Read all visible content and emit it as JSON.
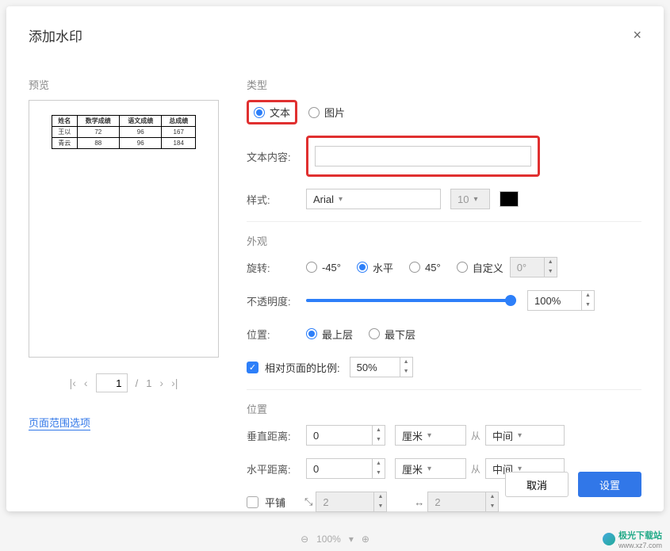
{
  "dialog": {
    "title": "添加水印",
    "close": "×"
  },
  "preview": {
    "title": "预览",
    "table": {
      "headers": [
        "姓名",
        "数学成绩",
        "语文成绩",
        "总成绩"
      ],
      "rows": [
        [
          "王以",
          "72",
          "96",
          "167"
        ],
        [
          "青云",
          "88",
          "96",
          "184"
        ]
      ]
    }
  },
  "pager": {
    "first": "|‹",
    "prev": "‹",
    "current": "1",
    "sep": "/",
    "total": "1",
    "next": "›",
    "last": "›|"
  },
  "page_range_link": "页面范围选项",
  "type_section": {
    "title": "类型",
    "text_radio": "文本",
    "image_radio": "图片",
    "content_label": "文本内容:",
    "content_value": "",
    "style_label": "样式:",
    "font": "Arial",
    "size": "10"
  },
  "appearance": {
    "title": "外观",
    "rotate_label": "旋转:",
    "rot_m45": "-45°",
    "rot_0": "水平",
    "rot_45": "45°",
    "rot_custom": "自定义",
    "rot_value": "0°",
    "opacity_label": "不透明度:",
    "opacity_value": "100%",
    "pos_label": "位置:",
    "pos_top": "最上层",
    "pos_bottom": "最下层",
    "relative_label": "相对页面的比例:",
    "relative_value": "50%"
  },
  "position": {
    "title": "位置",
    "vdist_label": "垂直距离:",
    "vdist_value": "0",
    "hdist_label": "水平距离:",
    "hdist_value": "0",
    "unit": "厘米",
    "from": "从",
    "ref": "中间",
    "tile_label": "平铺",
    "tile_a": "2",
    "tile_b": "2"
  },
  "footer": {
    "cancel": "取消",
    "ok": "设置"
  },
  "branding": {
    "name": "极光下载站",
    "url": "www.xz7.com"
  },
  "bottom_bar": {
    "zoom": "100%"
  }
}
